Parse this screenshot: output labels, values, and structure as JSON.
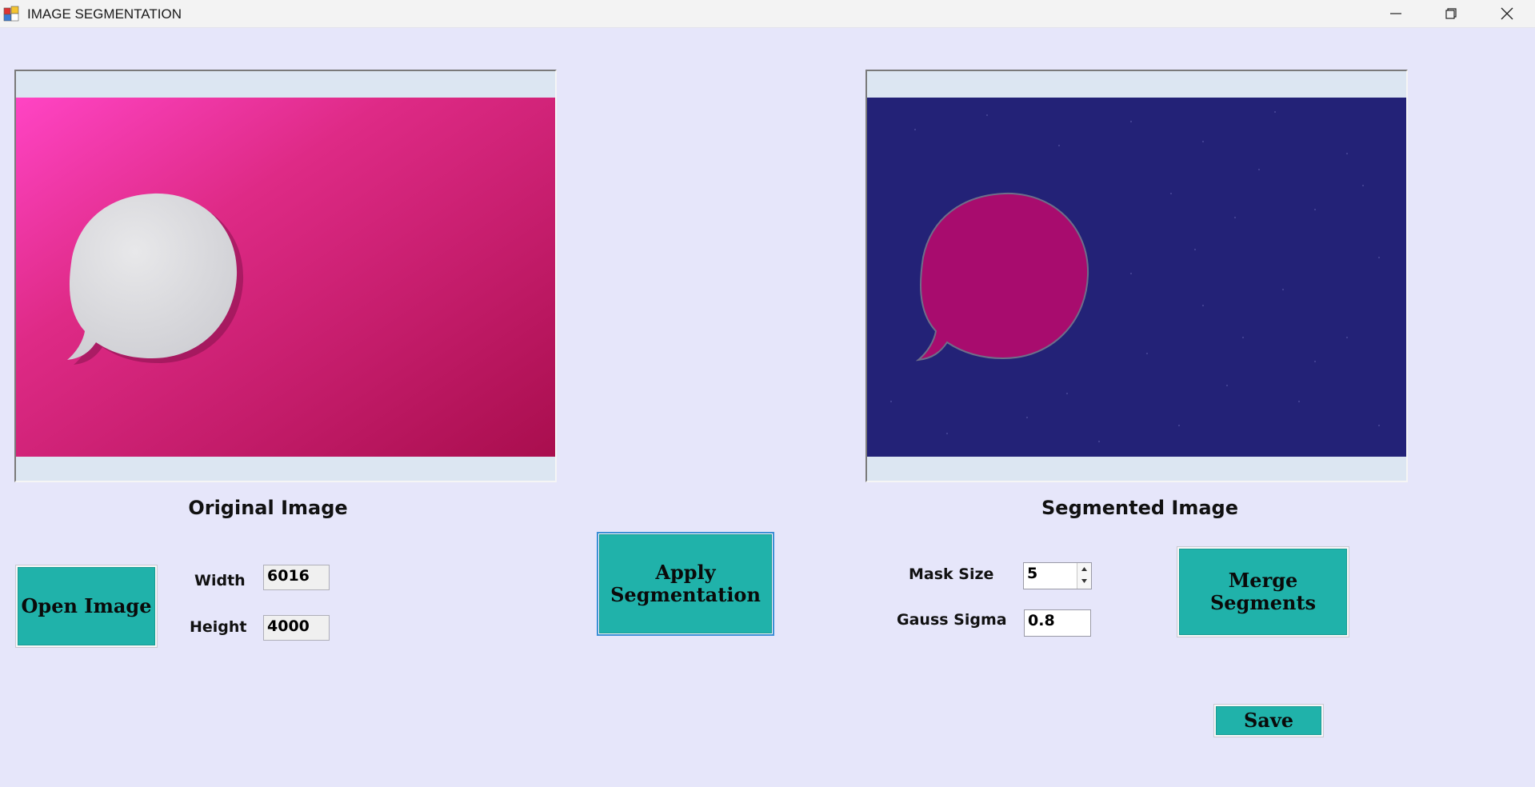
{
  "window": {
    "title": "IMAGE SEGMENTATION",
    "controls": [
      "minimize",
      "restore",
      "close"
    ]
  },
  "original_panel": {
    "caption": "Original Image",
    "image_description_icon": "speech-bubble-on-pink"
  },
  "segmented_panel": {
    "caption": "Segmented Image",
    "image_description_icon": "segmented-speech-bubble-on-navy"
  },
  "buttons": {
    "open_image": "Open Image",
    "apply_segmentation_line1": "Apply",
    "apply_segmentation_line2": "Segmentation",
    "merge_segments_line1": "Merge",
    "merge_segments_line2": "Segments",
    "save": "Save"
  },
  "dimensions": {
    "width_label": "Width",
    "width_value": "6016",
    "height_label": "Height",
    "height_value": "4000"
  },
  "params": {
    "mask_size_label": "Mask Size",
    "mask_size_value": "5",
    "gauss_sigma_label": "Gauss Sigma",
    "gauss_sigma_value": "0.8"
  },
  "colors": {
    "background": "#E6E6FA",
    "button": "#20B2AA",
    "original_bg_pink": "#D01F6E",
    "segmented_bg_navy": "#232277",
    "segmented_shape_magenta": "#A80C6E"
  }
}
